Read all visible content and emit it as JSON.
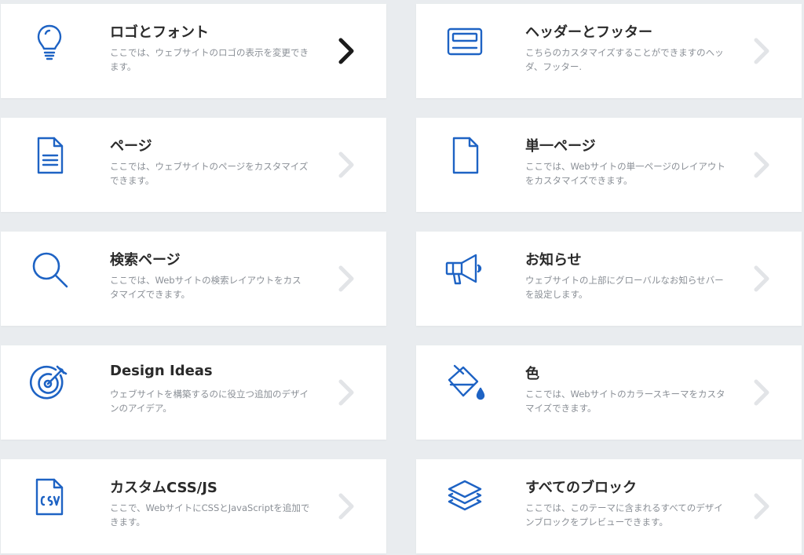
{
  "cards": [
    {
      "title": "ロゴとフォント",
      "desc": "ここでは、ウェブサイトのロゴの表示を変更できます。",
      "icon": "lightbulb-icon",
      "active": true
    },
    {
      "title": "ヘッダーとフッター",
      "desc": "こちらのカスタマイズすることができますのヘッダ、フッター.",
      "icon": "header-footer-icon",
      "active": false
    },
    {
      "title": "ページ",
      "desc": "ここでは、ウェブサイトのページをカスタマイズできます。",
      "icon": "page-icon",
      "active": false
    },
    {
      "title": "単一ページ",
      "desc": "ここでは、Webサイトの単一ページのレイアウトをカスタマイズできます。",
      "icon": "single-page-icon",
      "active": false
    },
    {
      "title": "検索ページ",
      "desc": "ここでは、Webサイトの検索レイアウトをカスタマイズできます。",
      "icon": "search-icon",
      "active": false
    },
    {
      "title": "お知らせ",
      "desc": "ウェブサイトの上部にグローバルなお知らせバーを設定します。",
      "icon": "megaphone-icon",
      "active": false
    },
    {
      "title": "Design Ideas",
      "desc": "ウェブサイトを構築するのに役立つ追加のデザインのアイデア。",
      "icon": "target-icon",
      "active": false
    },
    {
      "title": "色",
      "desc": "ここでは、Webサイトのカラースキーマをカスタマイズできます。",
      "icon": "paint-bucket-icon",
      "active": false
    },
    {
      "title": "カスタムCSS/JS",
      "desc": "ここで、WebサイトにCSSとJavaScriptを追加できます。",
      "icon": "csv-file-icon",
      "active": false
    },
    {
      "title": "すべてのブロック",
      "desc": "ここでは、このテーマに含まれるすべてのデザインブロックをプレビューできます。",
      "icon": "layers-icon",
      "active": false
    }
  ],
  "colors": {
    "icon": "#1e63c4",
    "chevron_active": "#1b1b1b",
    "chevron_inactive": "#e2e4e7"
  }
}
